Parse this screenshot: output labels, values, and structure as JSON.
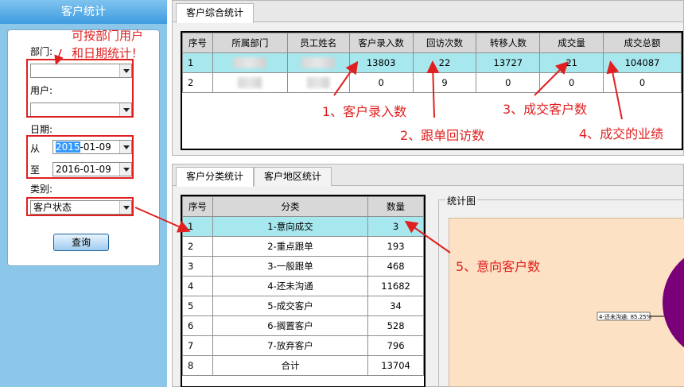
{
  "sidebar": {
    "title": "客户统计",
    "dept_label": "部门:",
    "user_label": "用户:",
    "date_label": "日期:",
    "from_label": "从",
    "to_label": "至",
    "date_from_year": "2015",
    "date_from_rest": "-01-09",
    "date_to": "2016-01-09",
    "type_label": "类别:",
    "type_value": "客户状态",
    "query_label": "查询",
    "note_line1": "可按部门用户",
    "note_line2": "和日期统计！"
  },
  "top_tabs": [
    {
      "label": "客户综合统计"
    }
  ],
  "summary_table": {
    "headers": [
      "序号",
      "所属部门",
      "员工姓名",
      "客户录入数",
      "回访次数",
      "转移人数",
      "成交量",
      "成交总额"
    ],
    "rows": [
      [
        "1",
        "",
        "",
        "13803",
        "22",
        "13727",
        "21",
        "104087"
      ],
      [
        "2",
        "",
        "",
        "0",
        "9",
        "0",
        "0",
        "0"
      ]
    ]
  },
  "annotations": {
    "a1": "1、客户录入数",
    "a2": "2、跟单回访数",
    "a3": "3、成交客户数",
    "a4": "4、成交的业绩",
    "a5": "5、意向客户数"
  },
  "bottom_tabs": [
    {
      "label": "客户分类统计"
    },
    {
      "label": "客户地区统计"
    }
  ],
  "category_table": {
    "headers": [
      "序号",
      "分类",
      "数量"
    ],
    "rows": [
      [
        "1",
        "1-意向成交",
        "3"
      ],
      [
        "2",
        "2-重点跟单",
        "193"
      ],
      [
        "3",
        "3-一般跟单",
        "468"
      ],
      [
        "4",
        "4-还未沟通",
        "11682"
      ],
      [
        "5",
        "5-成交客户",
        "34"
      ],
      [
        "6",
        "6-搁置客户",
        "528"
      ],
      [
        "7",
        "7-放弃客户",
        "796"
      ],
      [
        "8",
        "合计",
        "13704"
      ]
    ]
  },
  "chart": {
    "group_label": "统计图",
    "slice_label": "4-还未沟通: 85.25%",
    "slice_color": "#7a007a",
    "background_color": "#fde1c4"
  },
  "colors": {
    "accent": "#e02020",
    "selected_row": "#a7e8ee"
  }
}
